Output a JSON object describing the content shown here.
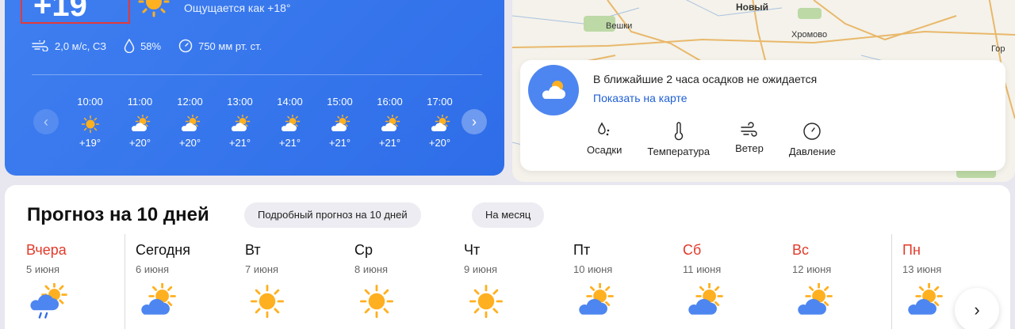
{
  "now": {
    "temp": "+19",
    "feels_like": "Ощущается как +18°",
    "wind": "2,0 м/с, СЗ",
    "humidity": "58%",
    "pressure": "750 мм рт. ст.",
    "icons": {
      "wind": "wind-icon",
      "humidity": "drop-icon",
      "pressure": "gauge-icon",
      "weather": "sun-icon"
    }
  },
  "hourly": [
    {
      "time": "10:00",
      "temp": "+19°",
      "icon": "sun-icon"
    },
    {
      "time": "11:00",
      "temp": "+20°",
      "icon": "partly-cloudy-icon"
    },
    {
      "time": "12:00",
      "temp": "+20°",
      "icon": "partly-cloudy-icon"
    },
    {
      "time": "13:00",
      "temp": "+21°",
      "icon": "partly-cloudy-icon"
    },
    {
      "time": "14:00",
      "temp": "+21°",
      "icon": "partly-cloudy-icon"
    },
    {
      "time": "15:00",
      "temp": "+21°",
      "icon": "partly-cloudy-icon"
    },
    {
      "time": "16:00",
      "temp": "+21°",
      "icon": "partly-cloudy-icon"
    },
    {
      "time": "17:00",
      "temp": "+20°",
      "icon": "partly-cloudy-icon"
    }
  ],
  "map": {
    "labels": [
      "Новый",
      "Вешки",
      "Хромово",
      "Гор"
    ],
    "precip_text": "В ближайшие 2 часа осадков не ожидается",
    "precip_link": "Показать на карте",
    "tabs": [
      "Осадки",
      "Температура",
      "Ветер",
      "Давление"
    ]
  },
  "forecast": {
    "title": "Прогноз на 10 дней",
    "detailed_button": "Подробный прогноз на 10 дней",
    "month_button": "На месяц",
    "days": [
      {
        "name": "Вчера",
        "date": "5 июня",
        "weekend": true,
        "icon": "rain-cloud-icon"
      },
      {
        "name": "Сегодня",
        "date": "6 июня",
        "weekend": false,
        "icon": "partly-cloudy-icon"
      },
      {
        "name": "Вт",
        "date": "7 июня",
        "weekend": false,
        "icon": "sun-icon"
      },
      {
        "name": "Ср",
        "date": "8 июня",
        "weekend": false,
        "icon": "sun-icon"
      },
      {
        "name": "Чт",
        "date": "9 июня",
        "weekend": false,
        "icon": "sun-icon"
      },
      {
        "name": "Пт",
        "date": "10 июня",
        "weekend": false,
        "icon": "partly-cloudy-icon"
      },
      {
        "name": "Сб",
        "date": "11 июня",
        "weekend": true,
        "icon": "partly-cloudy-icon"
      },
      {
        "name": "Вс",
        "date": "12 июня",
        "weekend": true,
        "icon": "partly-cloudy-icon"
      },
      {
        "name": "Пн",
        "date": "13 июня",
        "weekend": true,
        "icon": "partly-cloudy-icon"
      }
    ]
  },
  "colors": {
    "card_blue": "#3f7ff0",
    "accent_red": "#e23a2a",
    "link_blue": "#1f5fd6",
    "sun": "#ffb020"
  }
}
